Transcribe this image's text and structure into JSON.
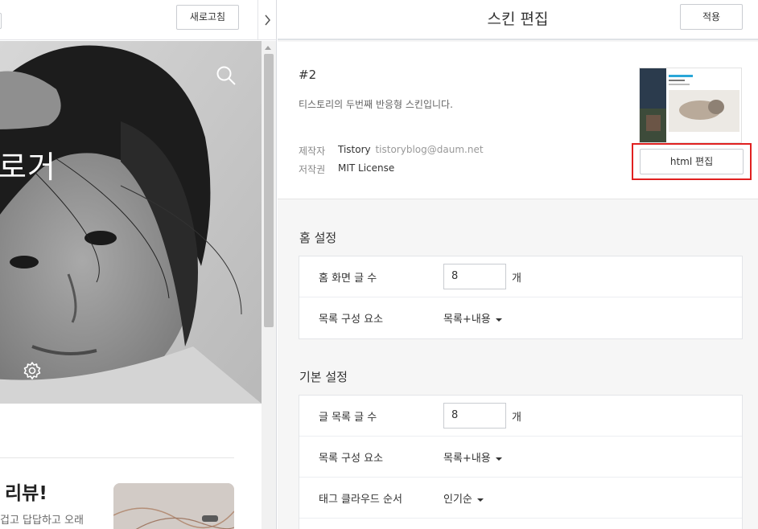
{
  "left_pane": {
    "refresh_label": "새로고침",
    "blog_title_fragment": "로거",
    "post": {
      "title_fragment": "리뷰!",
      "excerpt_fragment": "겁고 답답하고 오래"
    }
  },
  "right_pane": {
    "header_title": "스킨 편집",
    "apply_label": "적용",
    "skin": {
      "name": "#2",
      "description": "티스토리의 두번째 반응형 스킨입니다.",
      "author_label": "제작자",
      "author_name": "Tistory",
      "author_email": "tistoryblog@daum.net",
      "license_label": "저작권",
      "license_value": "MIT License",
      "html_edit_label": "html 편집"
    },
    "home_settings": {
      "title": "홈 설정",
      "post_count_label": "홈 화면 글 수",
      "post_count_value": "8",
      "post_count_unit": "개",
      "list_component_label": "목록 구성 요소",
      "list_component_value": "목록+내용"
    },
    "basic_settings": {
      "title": "기본 설정",
      "list_count_label": "글 목록 글 수",
      "list_count_value": "8",
      "list_count_unit": "개",
      "list_component_label": "목록 구성 요소",
      "list_component_value": "목록+내용",
      "tag_cloud_label": "태그 클라우드 순서",
      "tag_cloud_value": "인기순"
    }
  },
  "colors": {
    "highlight_border": "#e02020",
    "panel_bg": "#f6f6f6"
  }
}
